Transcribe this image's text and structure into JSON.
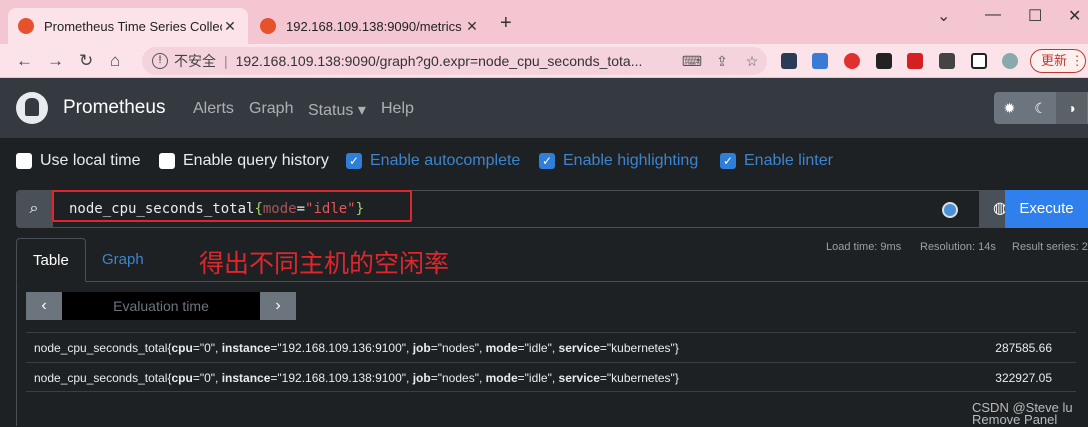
{
  "browser": {
    "tabs": [
      {
        "title": "Prometheus Time Series Collec"
      },
      {
        "title": "192.168.109.138:9090/metrics"
      }
    ],
    "new_tab": "+",
    "insecure_label": "不安全",
    "url": "192.168.109.138:9090/graph?g0.expr=node_cpu_seconds_tota...",
    "update_button": "更新"
  },
  "navbar": {
    "brand": "Prometheus",
    "links": [
      "Alerts",
      "Graph",
      "Status",
      "Help"
    ]
  },
  "options": [
    {
      "label": "Use local time",
      "checked": false
    },
    {
      "label": "Enable query history",
      "checked": false
    },
    {
      "label": "Enable autocomplete",
      "checked": true
    },
    {
      "label": "Enable highlighting",
      "checked": true
    },
    {
      "label": "Enable linter",
      "checked": true
    }
  ],
  "query": {
    "metric": "node_cpu_seconds_total",
    "open": "{",
    "label_key": "mode",
    "operator": "=",
    "label_value": "\"idle\"",
    "close": "}",
    "execute_label": "Execute"
  },
  "tabs": {
    "table": "Table",
    "graph": "Graph"
  },
  "annotation": "得出不同主机的空闲率",
  "stats": {
    "load_time": "Load time: 9ms",
    "resolution": "Resolution: 14s",
    "result_series": "Result series: 2"
  },
  "evaluation_placeholder": "Evaluation time",
  "results": [
    {
      "metric": "node_cpu_seconds_total",
      "labels": [
        {
          "k": "cpu",
          "v": "\"0\""
        },
        {
          "k": "instance",
          "v": "\"192.168.109.136:9100\""
        },
        {
          "k": "job",
          "v": "\"nodes\""
        },
        {
          "k": "mode",
          "v": "\"idle\""
        },
        {
          "k": "service",
          "v": "\"kubernetes\""
        }
      ],
      "value": "287585.66"
    },
    {
      "metric": "node_cpu_seconds_total",
      "labels": [
        {
          "k": "cpu",
          "v": "\"0\""
        },
        {
          "k": "instance",
          "v": "\"192.168.109.138:9100\""
        },
        {
          "k": "job",
          "v": "\"nodes\""
        },
        {
          "k": "mode",
          "v": "\"idle\""
        },
        {
          "k": "service",
          "v": "\"kubernetes\""
        }
      ],
      "value": "322927.05"
    }
  ],
  "watermark": {
    "line1": "CSDN @Steve lu",
    "line2": "Remove Panel"
  }
}
